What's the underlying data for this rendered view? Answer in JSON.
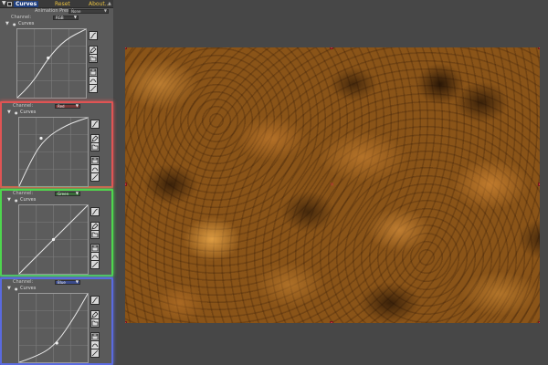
{
  "effect_controls": {
    "effect_name": "Curves",
    "reset_label": "Reset",
    "about_label": "About...",
    "animation_presets_label": "Animation Presets:",
    "animation_presets_value": "None",
    "scroll_arrow": "▲"
  },
  "sections": [
    {
      "channel_label": "Channel:",
      "channel_value": "RGB",
      "curves_label": "Curves",
      "frame_color": "",
      "select_color": "#3d3d3d",
      "curve_points": [
        [
          0,
          1
        ],
        [
          0.2,
          0.82
        ],
        [
          0.45,
          0.42
        ],
        [
          0.7,
          0.15
        ],
        [
          1,
          0
        ]
      ],
      "control_point": [
        0.45,
        0.42
      ]
    },
    {
      "channel_label": "Channel:",
      "channel_value": "Red",
      "curves_label": "Curves",
      "frame_color": "#e05454",
      "select_color": "#7a3a3a",
      "curve_points": [
        [
          0,
          1
        ],
        [
          0.18,
          0.6
        ],
        [
          0.38,
          0.3
        ],
        [
          0.7,
          0.1
        ],
        [
          1,
          0
        ]
      ],
      "control_point": [
        0.32,
        0.3
      ]
    },
    {
      "channel_label": "Channel:",
      "channel_value": "Green",
      "curves_label": "Curves",
      "frame_color": "#4ed64e",
      "select_color": "#3a6a3a",
      "curve_points": [
        [
          0,
          1
        ],
        [
          0.25,
          0.75
        ],
        [
          0.5,
          0.5
        ],
        [
          0.75,
          0.25
        ],
        [
          1,
          0
        ]
      ],
      "control_point": [
        0.5,
        0.5
      ]
    },
    {
      "channel_label": "Channel:",
      "channel_value": "Blue",
      "curves_label": "Curves",
      "frame_color": "#5a6adf",
      "select_color": "#3a4a8a",
      "curve_points": [
        [
          0,
          1
        ],
        [
          0.3,
          0.9
        ],
        [
          0.55,
          0.72
        ],
        [
          0.8,
          0.35
        ],
        [
          1,
          0
        ]
      ],
      "control_point": [
        0.55,
        0.72
      ]
    }
  ],
  "tools": [
    "curve-pen-icon",
    "pencil-icon",
    "open-file-icon",
    "save-file-icon",
    "smooth-icon",
    "reset-line-icon"
  ],
  "colors": {
    "handle": "#c0393a",
    "texture_base": "#8a5418"
  }
}
